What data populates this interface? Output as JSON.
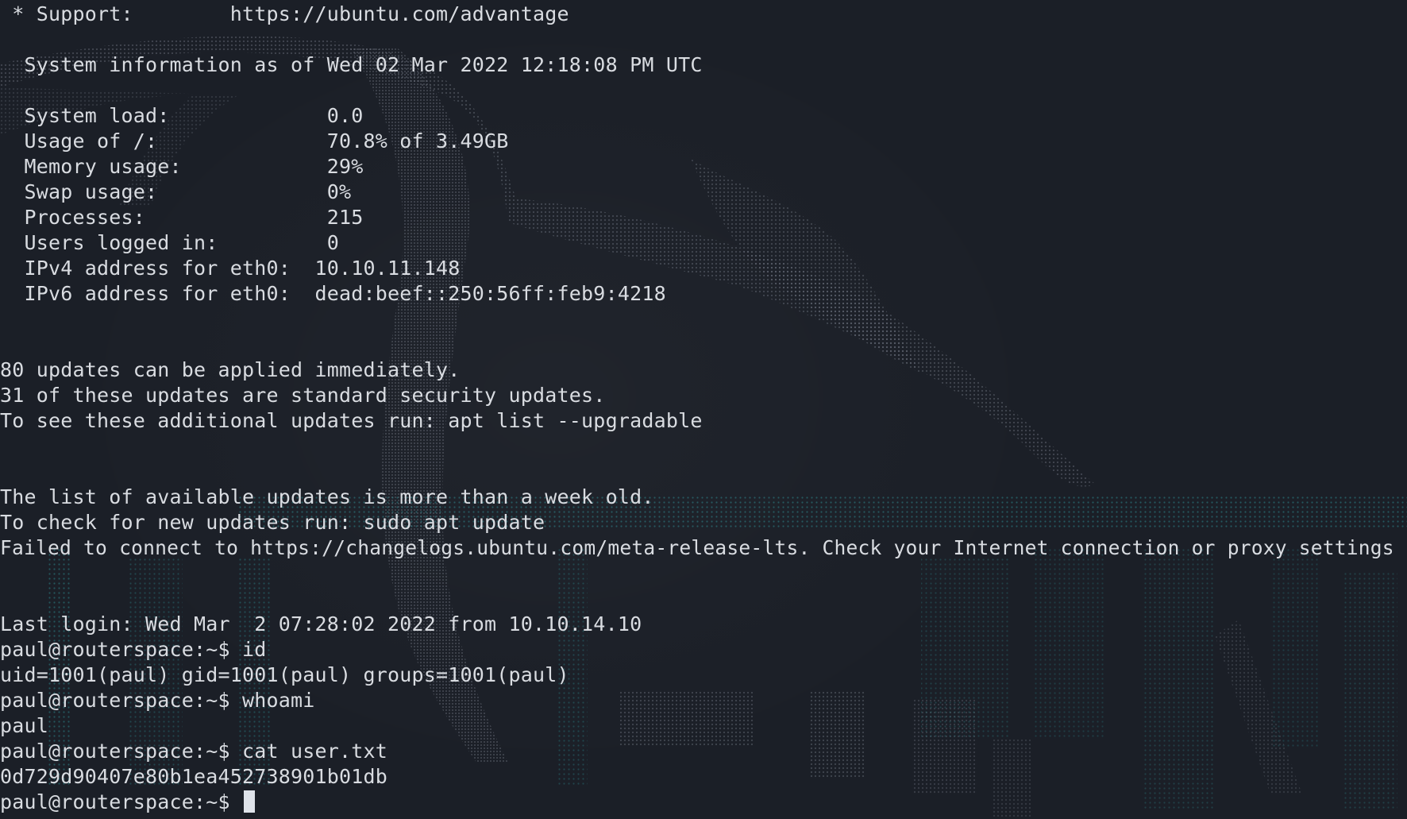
{
  "terminal": {
    "lines": [
      {
        "text": " * Support:        https://ubuntu.com/advantage"
      },
      {
        "text": ""
      },
      {
        "text": "  System information as of Wed 02 Mar 2022 12:18:08 PM UTC"
      },
      {
        "text": ""
      },
      {
        "text": "  System load:             0.0"
      },
      {
        "text": "  Usage of /:              70.8% of 3.49GB"
      },
      {
        "text": "  Memory usage:            29%"
      },
      {
        "text": "  Swap usage:              0%"
      },
      {
        "text": "  Processes:               215"
      },
      {
        "text": "  Users logged in:         0"
      },
      {
        "text": "  IPv4 address for eth0:  10.10.11.148"
      },
      {
        "text": "  IPv6 address for eth0:  dead:beef::250:56ff:feb9:4218"
      },
      {
        "text": ""
      },
      {
        "text": ""
      },
      {
        "text": "80 updates can be applied immediately."
      },
      {
        "text": "31 of these updates are standard security updates."
      },
      {
        "text": "To see these additional updates run: apt list --upgradable"
      },
      {
        "text": ""
      },
      {
        "text": ""
      },
      {
        "text": "The list of available updates is more than a week old."
      },
      {
        "text": "To check for new updates run: sudo apt update"
      },
      {
        "text": "Failed to connect to https://changelogs.ubuntu.com/meta-release-lts. Check your Internet connection or proxy settings"
      },
      {
        "text": ""
      },
      {
        "text": ""
      },
      {
        "text": "Last login: Wed Mar  2 07:28:02 2022 from 10.10.14.10"
      },
      {
        "text": "paul@routerspace:~$ id"
      },
      {
        "text": "uid=1001(paul) gid=1001(paul) groups=1001(paul)"
      },
      {
        "text": "paul@routerspace:~$ whoami"
      },
      {
        "text": "paul"
      },
      {
        "text": "paul@routerspace:~$ cat user.txt"
      },
      {
        "text": "0d729d90407e80b1ea452738901b01db"
      },
      {
        "text": "paul@routerspace:~$ "
      }
    ]
  },
  "colors": {
    "background": "#1b1f27",
    "text": "#d9dce1",
    "art_gray": "#6f7682",
    "art_teal": "#2f8f95",
    "cursor": "#dfe3ea"
  }
}
